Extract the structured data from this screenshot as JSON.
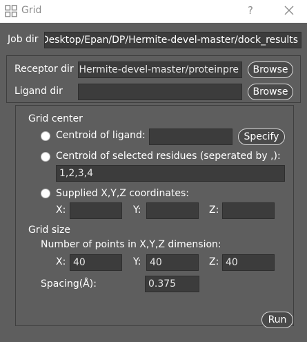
{
  "window": {
    "title": "Grid",
    "help_glyph": "?"
  },
  "job": {
    "label": "Job dir",
    "value": "C:/Users/Desktop/Epan/DP/Hermite-devel-master/dock_results"
  },
  "receptor": {
    "label": "Receptor dir",
    "value": "Hermite-devel-master/proteinpre",
    "button": "Browse"
  },
  "ligand": {
    "label": "Ligand dir",
    "value": "",
    "button": "Browse"
  },
  "grid_center": {
    "heading": "Grid center",
    "centroid_ligand": {
      "label": "Centroid of ligand:",
      "value": "",
      "button": "Specify"
    },
    "centroid_residues": {
      "label": "Centroid of selected residues (seperated by ,):",
      "value": "1,2,3,4"
    },
    "supplied": {
      "label": "Supplied X,Y,Z coordinates:",
      "x_label": "X:",
      "x_value": "",
      "y_label": "Y:",
      "y_value": "",
      "z_label": "Z:",
      "z_value": ""
    }
  },
  "grid_size": {
    "heading": "Grid size",
    "points_label": "Number of points in X,Y,Z dimension:",
    "x_label": "X:",
    "x_value": "40",
    "y_label": "Y:",
    "y_value": "40",
    "z_label": "Z:",
    "z_value": "40",
    "spacing_label": "Spacing(Å):",
    "spacing_value": "0.375"
  },
  "actions": {
    "run": "Run"
  }
}
